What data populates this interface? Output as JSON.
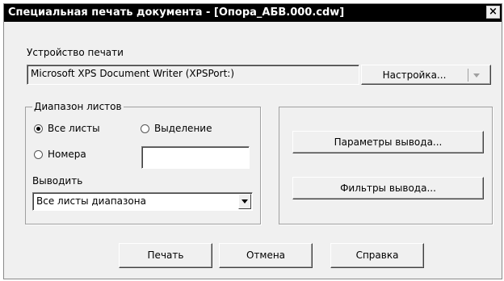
{
  "window": {
    "title": "Специальная печать документа - [Опора_АБВ.000.cdw]",
    "close_label": "×"
  },
  "device": {
    "label": "Устройство печати",
    "value": "Microsoft XPS Document Writer (XPSPort:)",
    "settings_button": "Настройка..."
  },
  "range": {
    "legend": "Диапазон листов",
    "all_sheets": "Все листы",
    "selection": "Выделение",
    "numbers": "Номера",
    "numbers_value": "",
    "selected": "all_sheets"
  },
  "output": {
    "label": "Выводить",
    "value": "Все листы диапазона"
  },
  "right_panel": {
    "output_params": "Параметры вывода...",
    "output_filters": "Фильтры вывода..."
  },
  "footer": {
    "print": "Печать",
    "cancel": "Отмена",
    "help": "Справка"
  }
}
